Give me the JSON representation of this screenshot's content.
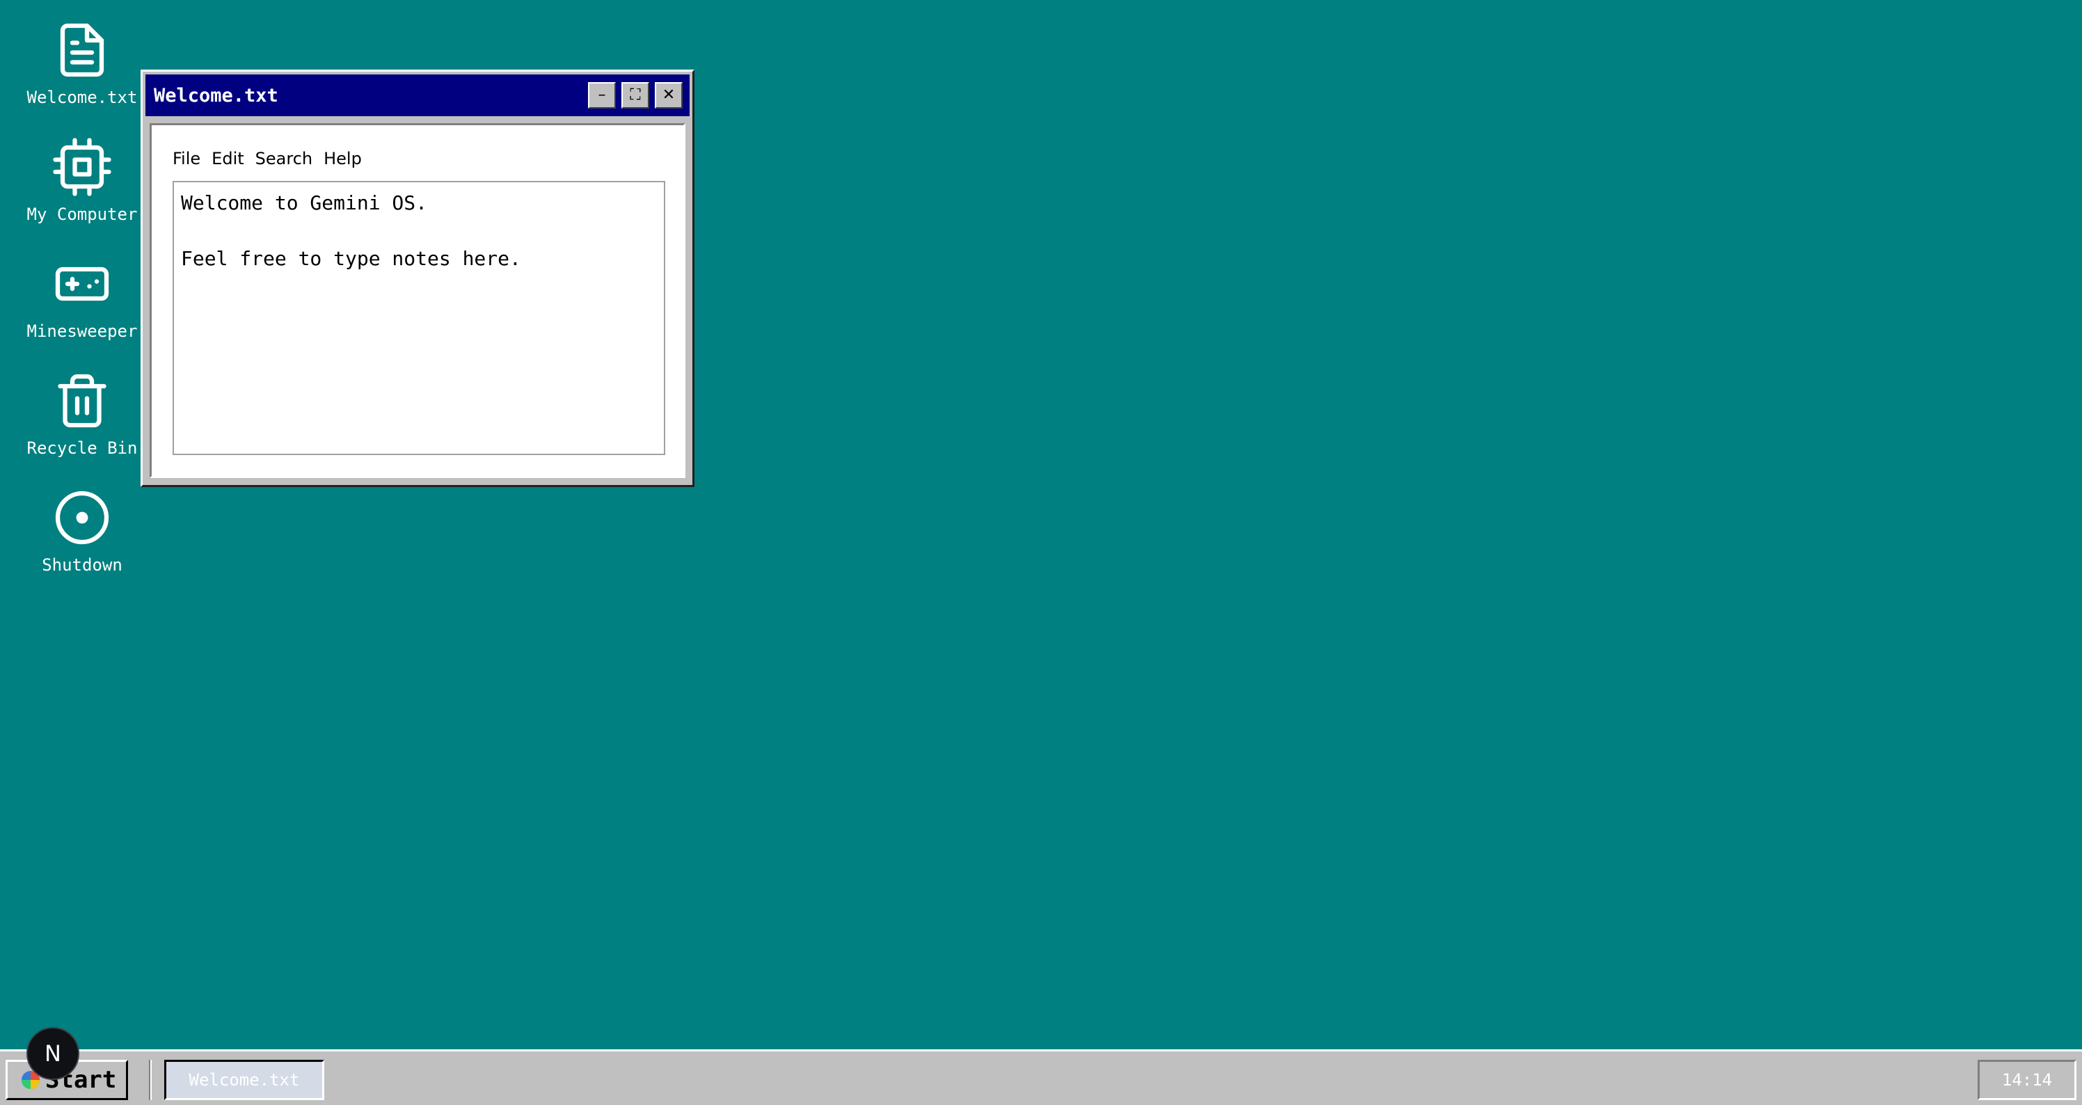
{
  "desktop": {
    "icons": [
      {
        "label": "Welcome.txt",
        "icon": "document-icon"
      },
      {
        "label": "My Computer",
        "icon": "cpu-chip-icon"
      },
      {
        "label": "Minesweeper",
        "icon": "gamepad-icon"
      },
      {
        "label": "Recycle Bin",
        "icon": "trash-icon"
      },
      {
        "label": "Shutdown",
        "icon": "power-disc-icon"
      }
    ]
  },
  "window": {
    "title": "Welcome.txt",
    "buttons": {
      "minimize": "–",
      "maximize": "⛶",
      "close": "✕"
    },
    "menu": [
      "File",
      "Edit",
      "Search",
      "Help"
    ],
    "content": "Welcome to Gemini OS.\n\nFeel free to type notes here."
  },
  "taskbar": {
    "start_label": "Start",
    "tasks": [
      {
        "label": "Welcome.txt"
      }
    ],
    "clock": "14:14"
  },
  "overlay": {
    "badge": "N"
  },
  "colors": {
    "desktop": "#008080",
    "titlebar": "#000080",
    "chrome": "#c0c0c0"
  }
}
